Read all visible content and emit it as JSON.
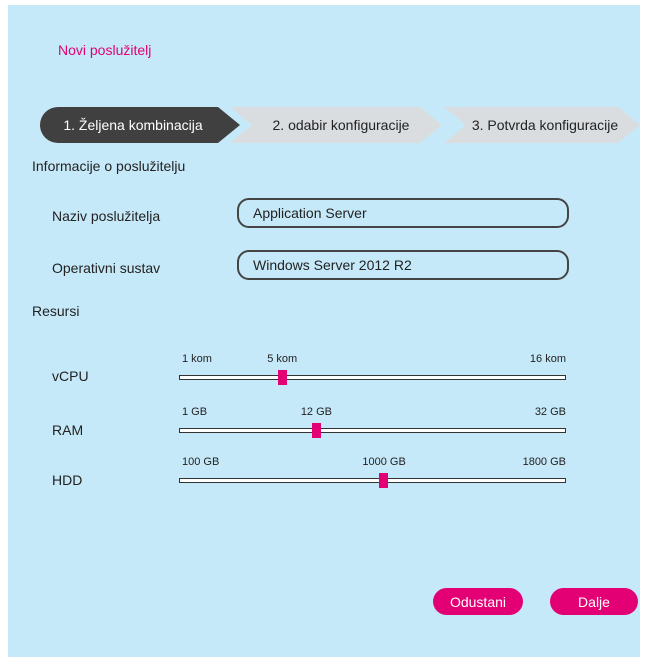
{
  "page": {
    "title": "Novi poslužitelj"
  },
  "steps": [
    {
      "label": "1. Željena kombinacija",
      "active": true
    },
    {
      "label": "2. odabir konfiguracije",
      "active": false
    },
    {
      "label": "3. Potvrda konfiguracije",
      "active": false
    }
  ],
  "info": {
    "heading": "Informacije o poslužitelju",
    "server_name_label": "Naziv poslužitelja",
    "server_name_value": "Application Server",
    "os_label": "Operativni sustav",
    "os_value": "Windows Server 2012 R2"
  },
  "resources": {
    "heading": "Resursi",
    "sliders": [
      {
        "label": "vCPU",
        "min": 1,
        "max": 16,
        "value": 5,
        "min_label": "1 kom",
        "max_label": "16 kom",
        "value_label": "5 kom"
      },
      {
        "label": "RAM",
        "min": 1,
        "max": 32,
        "value": 12,
        "min_label": "1 GB",
        "max_label": "32 GB",
        "value_label": "12 GB"
      },
      {
        "label": "HDD",
        "min": 100,
        "max": 1800,
        "value": 1000,
        "min_label": "100 GB",
        "max_label": "1800 GB",
        "value_label": "1000 GB"
      }
    ]
  },
  "buttons": {
    "cancel": "Odustani",
    "next": "Dalje"
  },
  "colors": {
    "accent": "#e20074",
    "background": "#c6e9f9",
    "active_step": "#404040",
    "inactive_step": "#d9dde0"
  }
}
